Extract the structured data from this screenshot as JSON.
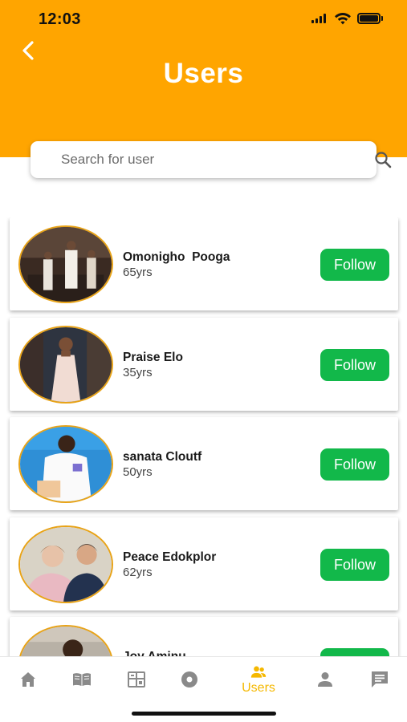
{
  "status_bar": {
    "time": "12:03"
  },
  "header": {
    "title": "Users",
    "back_icon": "chevron-left-icon"
  },
  "search": {
    "placeholder": "Search for user",
    "value": "",
    "icon": "search-icon"
  },
  "users": [
    {
      "name": "Omonigho  Pooga",
      "age": "65yrs",
      "action": "Follow"
    },
    {
      "name": "Praise Elo",
      "age": "35yrs",
      "action": "Follow"
    },
    {
      "name": "sanata Cloutf",
      "age": "50yrs",
      "action": "Follow"
    },
    {
      "name": "Peace Edokplor",
      "age": "62yrs",
      "action": "Follow"
    },
    {
      "name": "Joy Aminu",
      "age": "",
      "action": "Follow"
    }
  ],
  "tab_bar": {
    "active": "Users",
    "tabs": [
      {
        "icon": "home-icon"
      },
      {
        "icon": "book-icon"
      },
      {
        "icon": "dashboard-icon"
      },
      {
        "icon": "disc-icon"
      },
      {
        "icon": "users-icon",
        "label": "Users"
      },
      {
        "icon": "person-icon"
      },
      {
        "icon": "chat-icon"
      }
    ]
  },
  "colors": {
    "header": "#FFA500",
    "follow_button": "#12B84A",
    "active_tab": "#F5B800",
    "inactive_tab": "#8a8a8a",
    "avatar_ring": "#E8A317"
  }
}
